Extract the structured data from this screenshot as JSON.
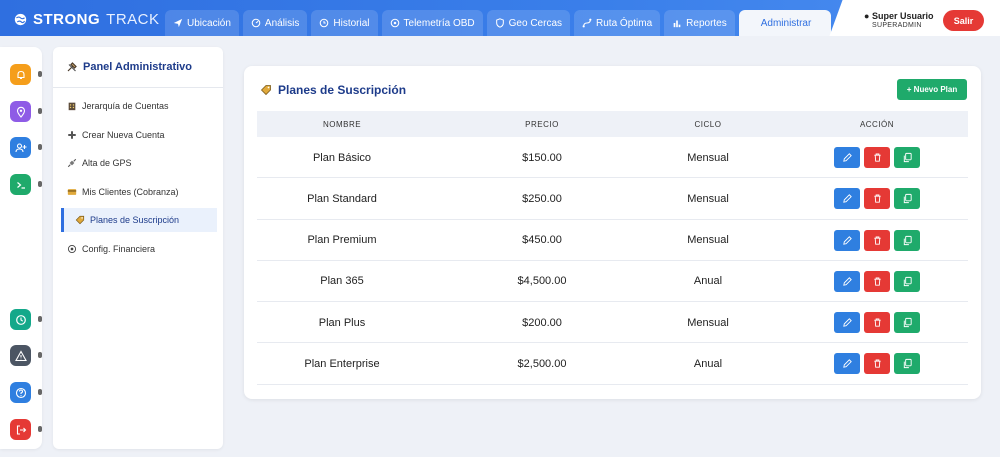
{
  "brand": {
    "primary": "STRONG",
    "secondary": "TRACK"
  },
  "nav": {
    "tabs": [
      {
        "label": "Ubicación",
        "icon": "send-icon"
      },
      {
        "label": "Análisis",
        "icon": "gauge-icon"
      },
      {
        "label": "Historial",
        "icon": "clock-icon"
      },
      {
        "label": "Telemetría OBD",
        "icon": "wifi-icon"
      },
      {
        "label": "Geo Cercas",
        "icon": "shield-icon"
      },
      {
        "label": "Ruta Óptima",
        "icon": "route-icon"
      },
      {
        "label": "Reportes",
        "icon": "bar-chart-icon"
      },
      {
        "label": "Administrar",
        "icon": "settings-icon"
      }
    ],
    "active_tab": "Administrar"
  },
  "user": {
    "name": "Super Usuario",
    "role": "SUPERADMIN",
    "logout_label": "Salir"
  },
  "rail": {
    "top_items": [
      {
        "icon": "bell-icon",
        "color": "#f59e1b"
      },
      {
        "icon": "map-pin-icon",
        "color": "#8e5ce6"
      },
      {
        "icon": "user-plus-icon",
        "color": "#2f7fe0"
      },
      {
        "icon": "terminal-icon",
        "color": "#1faa6b"
      }
    ],
    "bottom_items": [
      {
        "icon": "timer-icon",
        "color": "#14a88a"
      },
      {
        "icon": "warning-icon",
        "color": "#4b5563"
      },
      {
        "icon": "help-icon",
        "color": "#2f7fe0"
      },
      {
        "icon": "logout-icon",
        "color": "#e53935"
      }
    ]
  },
  "admin_panel": {
    "title": "Panel Administrativo",
    "items": [
      {
        "label": "Jerarquía de Cuentas",
        "icon": "building-icon"
      },
      {
        "label": "Crear Nueva Cuenta",
        "icon": "plus-icon"
      },
      {
        "label": "Alta de GPS",
        "icon": "satellite-icon"
      },
      {
        "label": "Mis Clientes (Cobranza)",
        "icon": "credit-card-icon"
      },
      {
        "label": "Planes de Suscripción",
        "icon": "tag-icon"
      },
      {
        "label": "Config. Financiera",
        "icon": "gear-icon"
      }
    ],
    "active_item": "Planes de Suscripción"
  },
  "plans": {
    "title": "Planes de Suscripción",
    "new_button": "+ Nuevo Plan",
    "columns": [
      "NOMBRE",
      "PRECIO",
      "CICLO",
      "ACCIÓN"
    ],
    "rows": [
      {
        "name": "Plan Básico",
        "price": "$150.00",
        "cycle": "Mensual"
      },
      {
        "name": "Plan Standard",
        "price": "$250.00",
        "cycle": "Mensual"
      },
      {
        "name": "Plan Premium",
        "price": "$450.00",
        "cycle": "Mensual"
      },
      {
        "name": "Plan 365",
        "price": "$4,500.00",
        "cycle": "Anual"
      },
      {
        "name": "Plan Plus",
        "price": "$200.00",
        "cycle": "Mensual"
      },
      {
        "name": "Plan Enterprise",
        "price": "$2,500.00",
        "cycle": "Anual"
      }
    ]
  },
  "colors": {
    "primary": "#2f6fe0",
    "success": "#1faa6b",
    "danger": "#e53935",
    "title": "#1d3b8a"
  }
}
